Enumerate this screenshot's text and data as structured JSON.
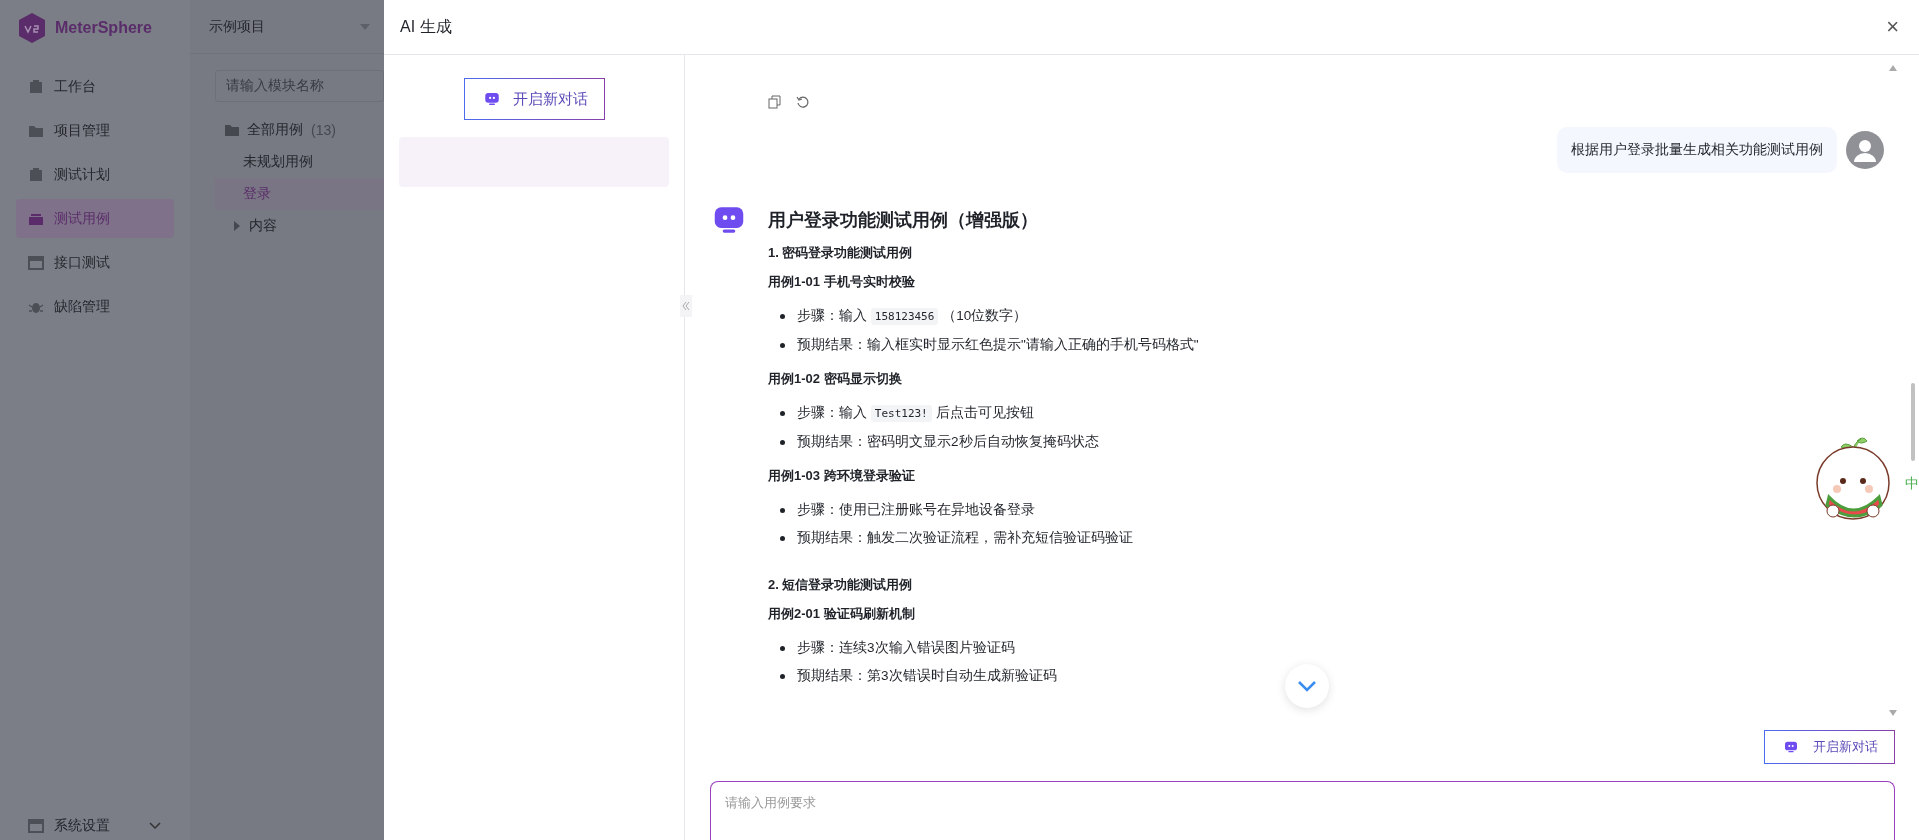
{
  "brand": {
    "name": "MeterSphere"
  },
  "nav": {
    "items": [
      {
        "label": "工作台",
        "selected": false
      },
      {
        "label": "项目管理",
        "selected": false
      },
      {
        "label": "测试计划",
        "selected": false
      },
      {
        "label": "测试用例",
        "selected": true
      },
      {
        "label": "接口测试",
        "selected": false
      },
      {
        "label": "缺陷管理",
        "selected": false
      }
    ],
    "footer": {
      "label": "系统设置"
    }
  },
  "module_panel": {
    "project": "示例项目",
    "search": {
      "placeholder": "请输入模块名称"
    },
    "tree": [
      {
        "label": "全部用例",
        "count": "(13)",
        "selected": false,
        "children": [
          {
            "label": "未规划用例",
            "selected": false
          },
          {
            "label": "登录",
            "selected": true
          },
          {
            "label": "内容",
            "selected": false,
            "expanded": false
          }
        ]
      }
    ]
  },
  "drawer": {
    "title": "AI 生成",
    "close": "×",
    "sidebar": {
      "new_chat": "开启新对话"
    },
    "chat": {
      "user_message": "根据用户登录批量生成相关功能测试用例",
      "reply": {
        "title": "用户登录功能测试用例（增强版）",
        "sections": [
          {
            "heading": "1. 密码登录功能测试用例",
            "cases": [
              {
                "title": "用例1-01 手机号实时校验",
                "bullets": [
                  [
                    {
                      "kind": "text",
                      "text": "步骤：输入 "
                    },
                    {
                      "kind": "code",
                      "text": "158123456"
                    },
                    {
                      "kind": "text",
                      "text": " （10位数字）"
                    }
                  ],
                  [
                    {
                      "kind": "text",
                      "text": "预期结果：输入框实时显示红色提示\"请输入正确的手机号码格式\""
                    }
                  ]
                ]
              },
              {
                "title": "用例1-02 密码显示切换",
                "bullets": [
                  [
                    {
                      "kind": "text",
                      "text": "步骤：输入 "
                    },
                    {
                      "kind": "code",
                      "text": "Test123!"
                    },
                    {
                      "kind": "text",
                      "text": " 后点击可见按钮"
                    }
                  ],
                  [
                    {
                      "kind": "text",
                      "text": "预期结果：密码明文显示2秒后自动恢复掩码状态"
                    }
                  ]
                ]
              },
              {
                "title": "用例1-03 跨环境登录验证",
                "bullets": [
                  [
                    {
                      "kind": "text",
                      "text": "步骤：使用已注册账号在异地设备登录"
                    }
                  ],
                  [
                    {
                      "kind": "text",
                      "text": "预期结果：触发二次验证流程，需补充短信验证码验证"
                    }
                  ]
                ]
              }
            ]
          },
          {
            "heading": "2. 短信登录功能测试用例",
            "cases": [
              {
                "title": "用例2-01 验证码刷新机制",
                "bullets": [
                  [
                    {
                      "kind": "text",
                      "text": "步骤：连续3次输入错误图片验证码"
                    }
                  ],
                  [
                    {
                      "kind": "text",
                      "text": "预期结果：第3次错误时自动生成新验证码"
                    }
                  ]
                ]
              }
            ]
          }
        ]
      },
      "new_chat": "开启新对话",
      "input": {
        "placeholder": "请输入用例要求"
      }
    },
    "mascot": {
      "status": "中"
    }
  }
}
